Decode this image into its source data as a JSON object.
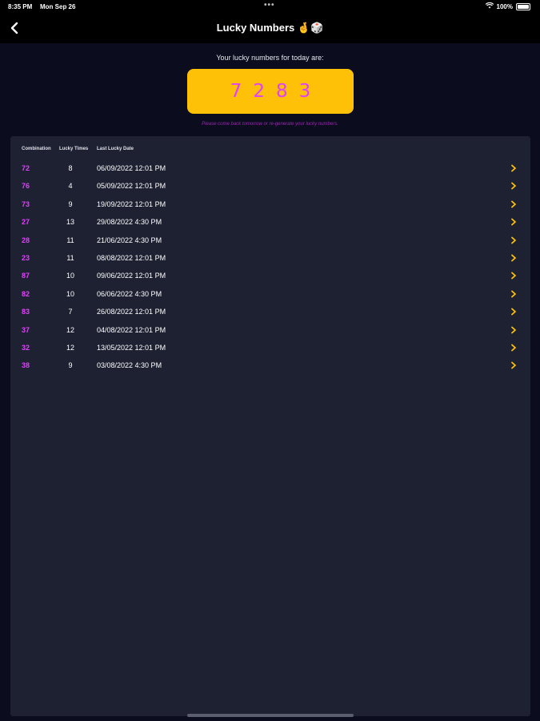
{
  "status_bar": {
    "time": "8:35 PM",
    "date": "Mon Sep 26",
    "battery": "100%"
  },
  "header": {
    "title": "Lucky Numbers 🤞🎲"
  },
  "lucky": {
    "intro": "Your lucky numbers for today are:",
    "digits": [
      "7",
      "2",
      "8",
      "3"
    ],
    "hint": "Please come back tomorrow or re-generate your lucky numbers."
  },
  "table": {
    "headers": [
      "Combination",
      "Lucky Times",
      "Last Lucky Date"
    ],
    "rows": [
      {
        "combination": "72",
        "times": "8",
        "date": "06/09/2022 12:01 PM"
      },
      {
        "combination": "76",
        "times": "4",
        "date": "05/09/2022 12:01 PM"
      },
      {
        "combination": "73",
        "times": "9",
        "date": "19/09/2022 12:01 PM"
      },
      {
        "combination": "27",
        "times": "13",
        "date": "29/08/2022 4:30 PM"
      },
      {
        "combination": "28",
        "times": "11",
        "date": "21/06/2022 4:30 PM"
      },
      {
        "combination": "23",
        "times": "11",
        "date": "08/08/2022 12:01 PM"
      },
      {
        "combination": "87",
        "times": "10",
        "date": "09/06/2022 12:01 PM"
      },
      {
        "combination": "82",
        "times": "10",
        "date": "06/06/2022 4:30 PM"
      },
      {
        "combination": "83",
        "times": "7",
        "date": "26/08/2022 12:01 PM"
      },
      {
        "combination": "37",
        "times": "12",
        "date": "04/08/2022 12:01 PM"
      },
      {
        "combination": "32",
        "times": "12",
        "date": "13/05/2022 12:01 PM"
      },
      {
        "combination": "38",
        "times": "9",
        "date": "03/08/2022 4:30 PM"
      }
    ]
  },
  "colors": {
    "accent": "#fec107",
    "combo": "#e040fb",
    "hint": "#9c27b0",
    "chevron": "#fec107"
  }
}
